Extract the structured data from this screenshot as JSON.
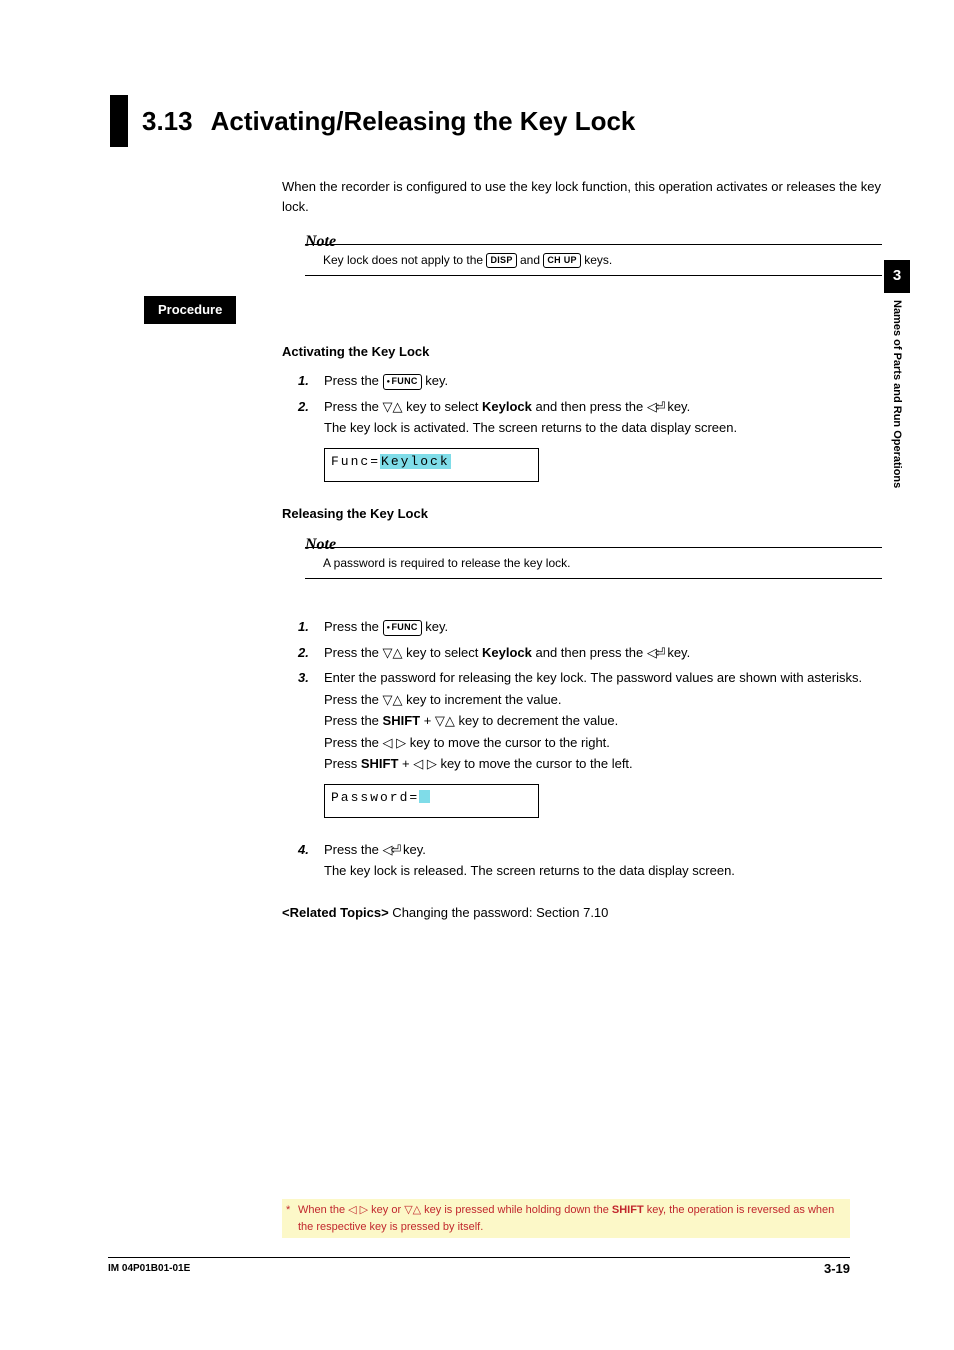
{
  "header": {
    "number": "3.13",
    "title": "Activating/Releasing the Key Lock"
  },
  "intro": "When the recorder is configured to use the key lock function, this operation activates or releases the key lock.",
  "note1": {
    "label": "Note",
    "pre": "Key lock does not apply to the ",
    "key1": "DISP",
    "mid": " and ",
    "key2": "CH UP",
    "post": " keys."
  },
  "procedure_label": "Procedure",
  "activating": {
    "heading": "Activating the Key Lock",
    "s1": {
      "n": "1.",
      "pre": "Press the ",
      "key": "FUNC",
      "post": " key."
    },
    "s2": {
      "n": "2.",
      "t1a": "Press the ",
      "t1b": " key to select ",
      "bold": "Keylock",
      "t1c": " and then press the ",
      "t1d": " key.",
      "t2": "The key lock is activated. The screen returns to the data display screen."
    },
    "lcd": {
      "prefix": "Func=",
      "value": "Keylock"
    }
  },
  "releasing": {
    "heading": "Releasing the Key Lock",
    "note": {
      "label": "Note",
      "text": "A password is required to release the key lock."
    },
    "s1": {
      "n": "1.",
      "pre": "Press the ",
      "key": "FUNC",
      "post": " key."
    },
    "s2": {
      "n": "2.",
      "a": "Press the ",
      "b": " key to select ",
      "bold": "Keylock",
      "c": " and then press the ",
      "d": " key."
    },
    "s3": {
      "n": "3.",
      "l1": "Enter the password for releasing the key lock. The password values are shown with asterisks.",
      "l2a": "Press the ",
      "l2b": " key to increment the value.",
      "l3a": "Press the ",
      "shift": "SHIFT",
      "l3b": " + ",
      "l3c": " key to decrement the value.",
      "l4a": "Press the ",
      "l4b": " key to move the cursor to the right.",
      "l5a": "Press ",
      "l5b": " + ",
      "l5c": " key to move the cursor to the left."
    },
    "lcd": {
      "prefix": "Password="
    },
    "s4": {
      "n": "4.",
      "a": "Press the ",
      "b": " key.",
      "t2": "The key lock is released. The screen returns to the data display screen."
    }
  },
  "related": {
    "label": "<Related Topics>",
    "text": "  Changing the password: Section 7.10"
  },
  "side": {
    "chapter": "3",
    "title": "Names of Parts and Run Operations"
  },
  "footnote": {
    "ast": "*",
    "a": "When the ",
    "b": " key or ",
    "c": " key is pressed while holding down the ",
    "shift": "SHIFT",
    "d": " key, the operation is reversed as when the respective key is pressed by itself."
  },
  "footer": {
    "left": "IM 04P01B01-01E",
    "right": "3-19"
  },
  "glyphs": {
    "updown": "▽△",
    "leftright": "◁ ▷",
    "enter": "◁⏎"
  }
}
